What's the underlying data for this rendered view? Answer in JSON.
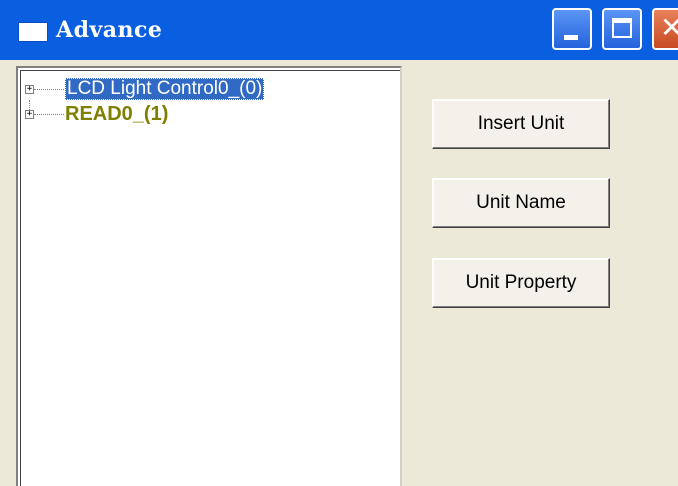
{
  "window": {
    "title": "Advance",
    "controls": {
      "minimize_icon": "minimize-icon",
      "maximize_icon": "maximize-icon",
      "close_icon": "close-icon",
      "close_glyph": "✕"
    }
  },
  "tree": {
    "nodes": [
      {
        "label": "LCD Light Control0_(0)",
        "expander": "+",
        "selected": true
      },
      {
        "label": "READ0_(1)",
        "expander": "+",
        "selected": false
      }
    ]
  },
  "actions": {
    "insert_unit": "Insert Unit",
    "unit_name": "Unit Name",
    "unit_property": "Unit Property"
  },
  "colors": {
    "titlebar": "#0a5fe0",
    "selection": "#316ac5",
    "node_text": "#808000",
    "dialog_bg": "#ece9d8"
  }
}
